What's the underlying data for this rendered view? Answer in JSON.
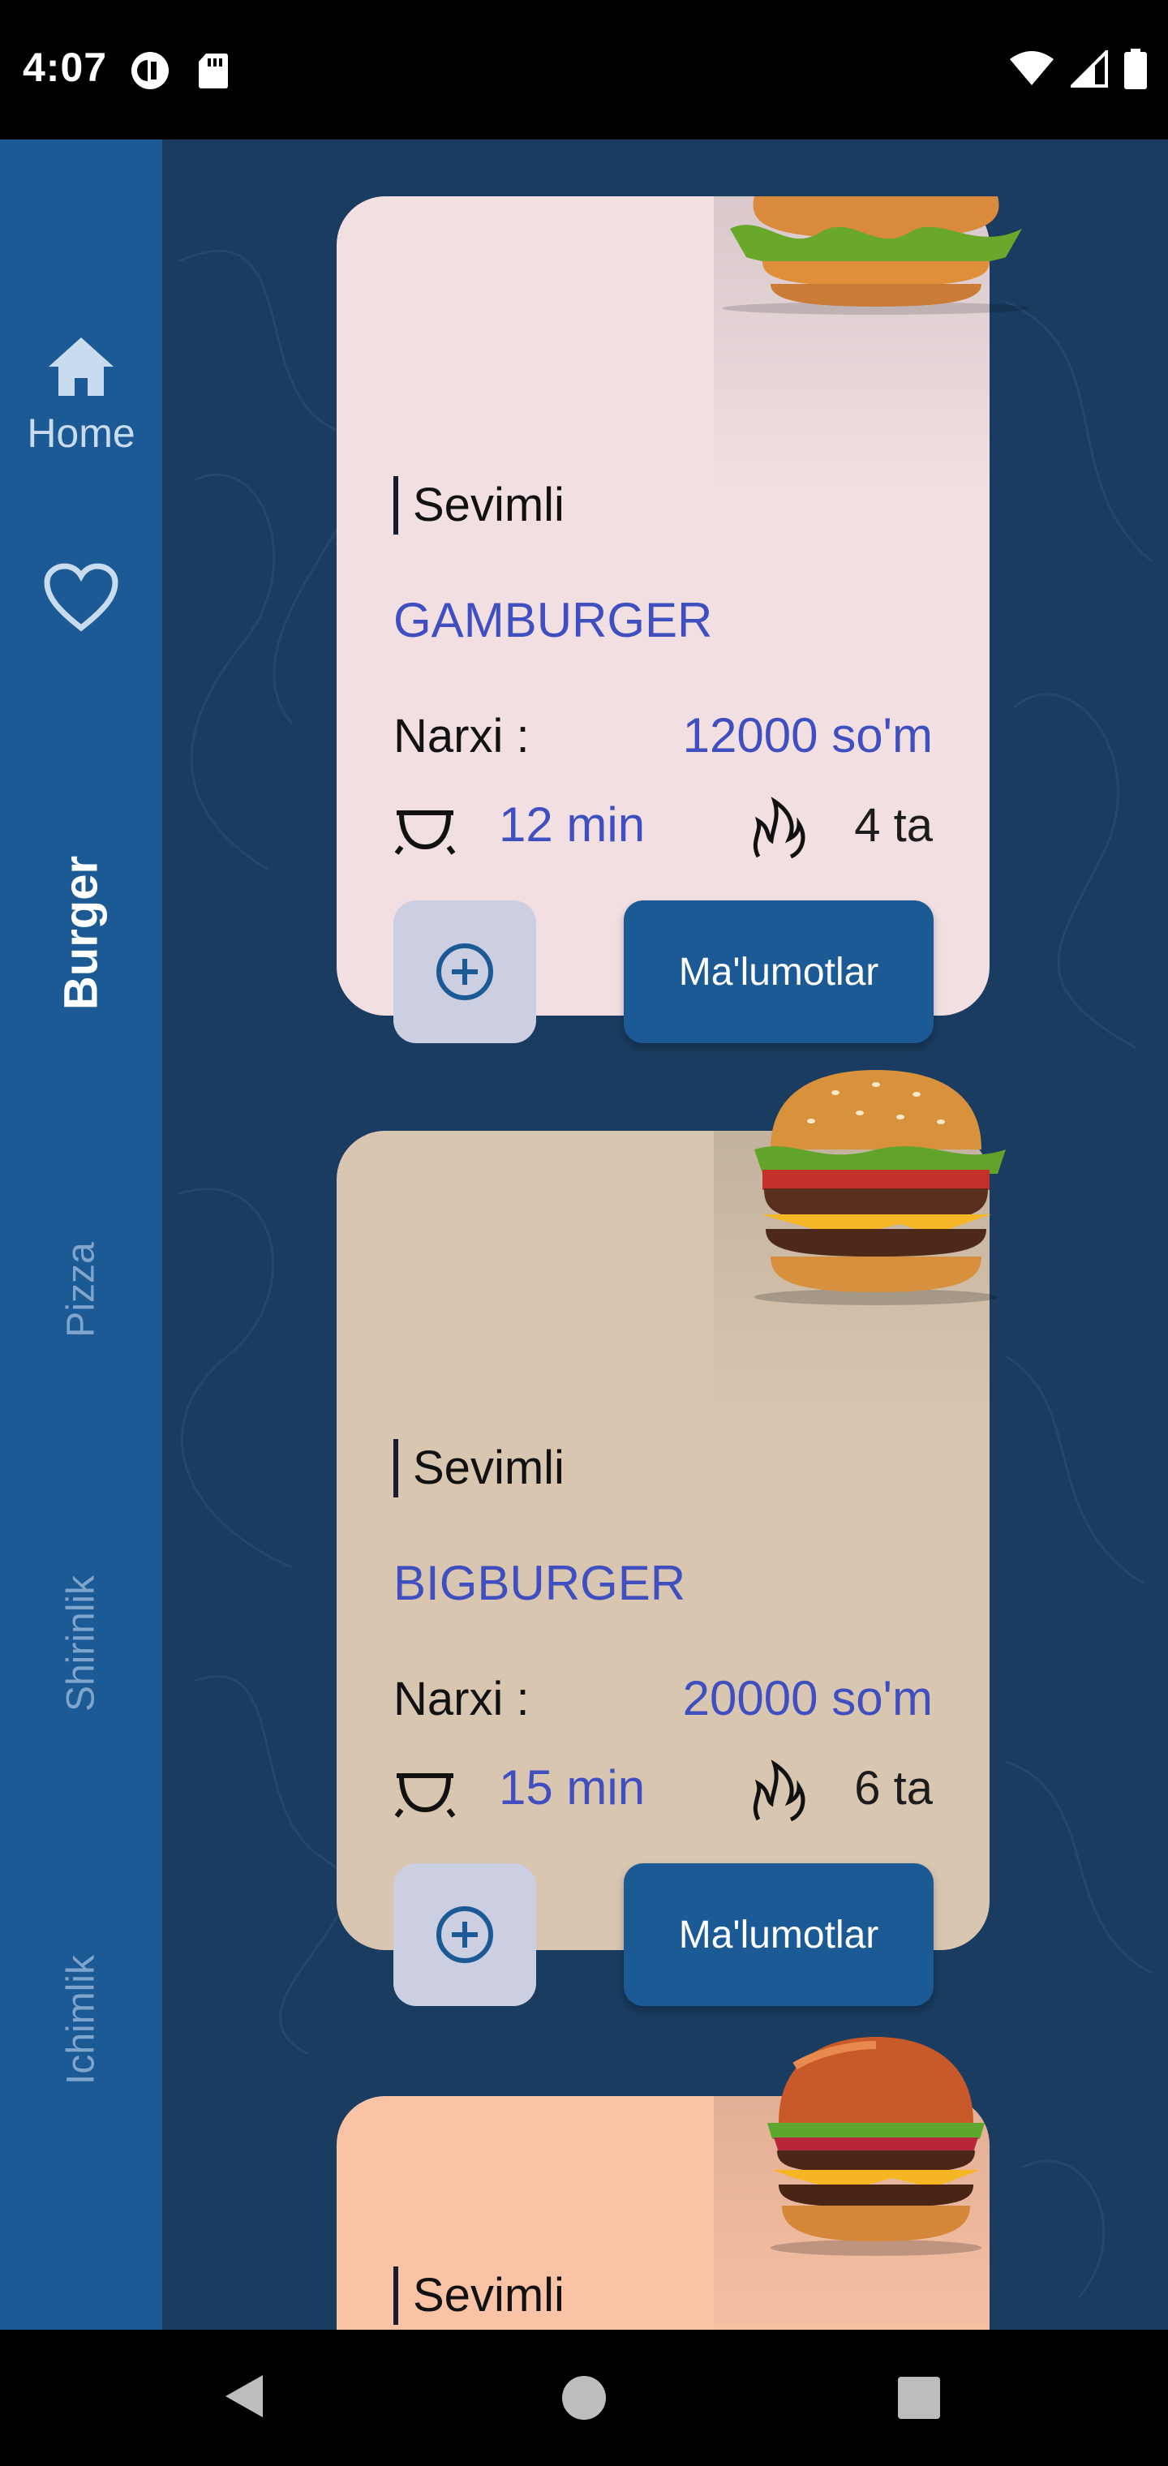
{
  "status_bar": {
    "time": "4:07"
  },
  "sidebar": {
    "home_label": "Home",
    "categories": [
      {
        "label": "Burger",
        "active": true
      },
      {
        "label": "Pizza",
        "active": false
      },
      {
        "label": "Shirinlik",
        "active": false
      },
      {
        "label": "Ichimlik",
        "active": false
      }
    ]
  },
  "cards": [
    {
      "badge": "Sevimli",
      "title": "GAMBURGER",
      "price_label": "Narxi :",
      "price": "12000 so'm",
      "time": "12 min",
      "count": "4 ta",
      "info_button": "Ma'lumotlar"
    },
    {
      "badge": "Sevimli",
      "title": "BIGBURGER",
      "price_label": "Narxi :",
      "price": "20000 so'm",
      "time": "15 min",
      "count": "6 ta",
      "info_button": "Ma'lumotlar"
    },
    {
      "badge": "Sevimli"
    }
  ],
  "colors": {
    "sidebar": "#1b5a94",
    "content": "#193c60",
    "accent": "#3f4fbf"
  }
}
